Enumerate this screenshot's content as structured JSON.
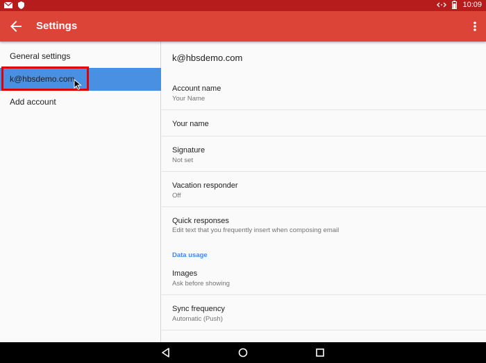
{
  "status_bar": {
    "time": "10:09",
    "left_icons": [
      "mail-icon",
      "shield-icon"
    ],
    "right_icons": [
      "data-arrows-icon",
      "battery-icon"
    ]
  },
  "app_bar": {
    "title": "Settings",
    "back_icon": "arrow-back-icon",
    "overflow_icon": "more-vert-icon",
    "color": "#db4437"
  },
  "sidebar": {
    "items": [
      {
        "label": "General settings"
      },
      {
        "label": "k@hbsdemo.com",
        "selected": true
      },
      {
        "label": "Add account"
      }
    ],
    "selected_color": "#4a90e2"
  },
  "account": {
    "email": "k@hbsdemo.com",
    "settings": [
      {
        "label": "Account name",
        "sub": "Your Name"
      },
      {
        "label": "Your name",
        "sub": ""
      },
      {
        "label": "Signature",
        "sub": "Not set"
      },
      {
        "label": "Vacation responder",
        "sub": "Off"
      },
      {
        "label": "Quick responses",
        "sub": "Edit text that you frequently insert when composing email"
      }
    ],
    "data_usage_header": "Data usage",
    "data_settings": [
      {
        "label": "Images",
        "sub": "Ask before showing"
      },
      {
        "label": "Sync frequency",
        "sub": "Automatic (Push)"
      }
    ]
  },
  "nav_bar": {
    "buttons": [
      "back-triangle-icon",
      "home-circle-icon",
      "recents-square-icon"
    ]
  }
}
